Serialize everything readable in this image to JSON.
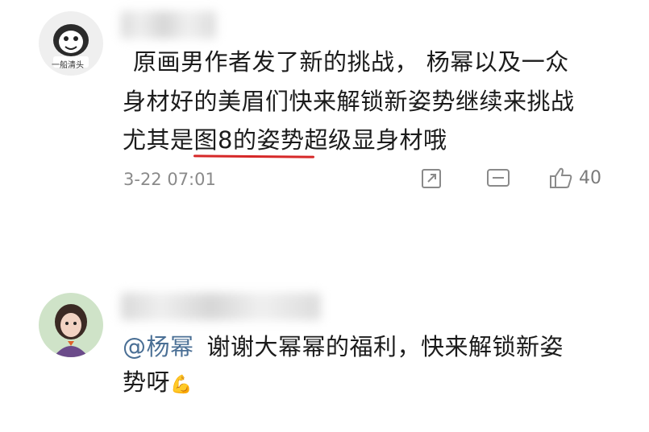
{
  "comments": [
    {
      "text_lines": [
        "原画男作者发了新的挑战， 杨幂以及一众",
        "身材好的美眉们快来解锁新姿势继续来挑战",
        "尤其是图8的姿势超级显身材哦"
      ],
      "time": "3-22 07:01",
      "likes": "40",
      "avatar_caption": "一船清头"
    },
    {
      "mention": "@杨幂",
      "text_lines": [
        "谢谢大幂幂的福利，快来解锁新姿",
        "势呀"
      ],
      "emoji": "💪"
    }
  ],
  "colors": {
    "underline": "#d62828",
    "mention": "#4a6f95",
    "meta": "#8a8a8a"
  },
  "icons": [
    "share-icon",
    "comment-icon",
    "like-icon"
  ]
}
